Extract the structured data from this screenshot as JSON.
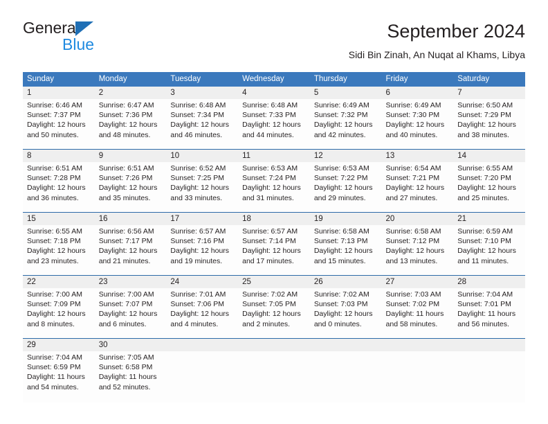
{
  "brand": {
    "name_top": "General",
    "name_bottom": "Blue",
    "triangle_icon": "triangle-icon",
    "color_dark": "#231f20",
    "color_blue": "#1f8ae0",
    "color_triangle": "#1f6fb5"
  },
  "header": {
    "title": "September 2024",
    "subtitle": "Sidi Bin Zinah, An Nuqat al Khams, Libya"
  },
  "theme": {
    "header_bg": "#3b79bd",
    "header_text": "#ffffff",
    "daystrip_bg": "#efefef",
    "week_divider": "#2c6aa8",
    "body_bg": "#fdfdfd"
  },
  "weekdays": [
    "Sunday",
    "Monday",
    "Tuesday",
    "Wednesday",
    "Thursday",
    "Friday",
    "Saturday"
  ],
  "weeks": [
    [
      {
        "day": "1",
        "lines": [
          "Sunrise: 6:46 AM",
          "Sunset: 7:37 PM",
          "Daylight: 12 hours",
          "and 50 minutes."
        ]
      },
      {
        "day": "2",
        "lines": [
          "Sunrise: 6:47 AM",
          "Sunset: 7:36 PM",
          "Daylight: 12 hours",
          "and 48 minutes."
        ]
      },
      {
        "day": "3",
        "lines": [
          "Sunrise: 6:48 AM",
          "Sunset: 7:34 PM",
          "Daylight: 12 hours",
          "and 46 minutes."
        ]
      },
      {
        "day": "4",
        "lines": [
          "Sunrise: 6:48 AM",
          "Sunset: 7:33 PM",
          "Daylight: 12 hours",
          "and 44 minutes."
        ]
      },
      {
        "day": "5",
        "lines": [
          "Sunrise: 6:49 AM",
          "Sunset: 7:32 PM",
          "Daylight: 12 hours",
          "and 42 minutes."
        ]
      },
      {
        "day": "6",
        "lines": [
          "Sunrise: 6:49 AM",
          "Sunset: 7:30 PM",
          "Daylight: 12 hours",
          "and 40 minutes."
        ]
      },
      {
        "day": "7",
        "lines": [
          "Sunrise: 6:50 AM",
          "Sunset: 7:29 PM",
          "Daylight: 12 hours",
          "and 38 minutes."
        ]
      }
    ],
    [
      {
        "day": "8",
        "lines": [
          "Sunrise: 6:51 AM",
          "Sunset: 7:28 PM",
          "Daylight: 12 hours",
          "and 36 minutes."
        ]
      },
      {
        "day": "9",
        "lines": [
          "Sunrise: 6:51 AM",
          "Sunset: 7:26 PM",
          "Daylight: 12 hours",
          "and 35 minutes."
        ]
      },
      {
        "day": "10",
        "lines": [
          "Sunrise: 6:52 AM",
          "Sunset: 7:25 PM",
          "Daylight: 12 hours",
          "and 33 minutes."
        ]
      },
      {
        "day": "11",
        "lines": [
          "Sunrise: 6:53 AM",
          "Sunset: 7:24 PM",
          "Daylight: 12 hours",
          "and 31 minutes."
        ]
      },
      {
        "day": "12",
        "lines": [
          "Sunrise: 6:53 AM",
          "Sunset: 7:22 PM",
          "Daylight: 12 hours",
          "and 29 minutes."
        ]
      },
      {
        "day": "13",
        "lines": [
          "Sunrise: 6:54 AM",
          "Sunset: 7:21 PM",
          "Daylight: 12 hours",
          "and 27 minutes."
        ]
      },
      {
        "day": "14",
        "lines": [
          "Sunrise: 6:55 AM",
          "Sunset: 7:20 PM",
          "Daylight: 12 hours",
          "and 25 minutes."
        ]
      }
    ],
    [
      {
        "day": "15",
        "lines": [
          "Sunrise: 6:55 AM",
          "Sunset: 7:18 PM",
          "Daylight: 12 hours",
          "and 23 minutes."
        ]
      },
      {
        "day": "16",
        "lines": [
          "Sunrise: 6:56 AM",
          "Sunset: 7:17 PM",
          "Daylight: 12 hours",
          "and 21 minutes."
        ]
      },
      {
        "day": "17",
        "lines": [
          "Sunrise: 6:57 AM",
          "Sunset: 7:16 PM",
          "Daylight: 12 hours",
          "and 19 minutes."
        ]
      },
      {
        "day": "18",
        "lines": [
          "Sunrise: 6:57 AM",
          "Sunset: 7:14 PM",
          "Daylight: 12 hours",
          "and 17 minutes."
        ]
      },
      {
        "day": "19",
        "lines": [
          "Sunrise: 6:58 AM",
          "Sunset: 7:13 PM",
          "Daylight: 12 hours",
          "and 15 minutes."
        ]
      },
      {
        "day": "20",
        "lines": [
          "Sunrise: 6:58 AM",
          "Sunset: 7:12 PM",
          "Daylight: 12 hours",
          "and 13 minutes."
        ]
      },
      {
        "day": "21",
        "lines": [
          "Sunrise: 6:59 AM",
          "Sunset: 7:10 PM",
          "Daylight: 12 hours",
          "and 11 minutes."
        ]
      }
    ],
    [
      {
        "day": "22",
        "lines": [
          "Sunrise: 7:00 AM",
          "Sunset: 7:09 PM",
          "Daylight: 12 hours",
          "and 8 minutes."
        ]
      },
      {
        "day": "23",
        "lines": [
          "Sunrise: 7:00 AM",
          "Sunset: 7:07 PM",
          "Daylight: 12 hours",
          "and 6 minutes."
        ]
      },
      {
        "day": "24",
        "lines": [
          "Sunrise: 7:01 AM",
          "Sunset: 7:06 PM",
          "Daylight: 12 hours",
          "and 4 minutes."
        ]
      },
      {
        "day": "25",
        "lines": [
          "Sunrise: 7:02 AM",
          "Sunset: 7:05 PM",
          "Daylight: 12 hours",
          "and 2 minutes."
        ]
      },
      {
        "day": "26",
        "lines": [
          "Sunrise: 7:02 AM",
          "Sunset: 7:03 PM",
          "Daylight: 12 hours",
          "and 0 minutes."
        ]
      },
      {
        "day": "27",
        "lines": [
          "Sunrise: 7:03 AM",
          "Sunset: 7:02 PM",
          "Daylight: 11 hours",
          "and 58 minutes."
        ]
      },
      {
        "day": "28",
        "lines": [
          "Sunrise: 7:04 AM",
          "Sunset: 7:01 PM",
          "Daylight: 11 hours",
          "and 56 minutes."
        ]
      }
    ],
    [
      {
        "day": "29",
        "lines": [
          "Sunrise: 7:04 AM",
          "Sunset: 6:59 PM",
          "Daylight: 11 hours",
          "and 54 minutes."
        ]
      },
      {
        "day": "30",
        "lines": [
          "Sunrise: 7:05 AM",
          "Sunset: 6:58 PM",
          "Daylight: 11 hours",
          "and 52 minutes."
        ]
      },
      {
        "day": "",
        "lines": []
      },
      {
        "day": "",
        "lines": []
      },
      {
        "day": "",
        "lines": []
      },
      {
        "day": "",
        "lines": []
      },
      {
        "day": "",
        "lines": []
      }
    ]
  ]
}
